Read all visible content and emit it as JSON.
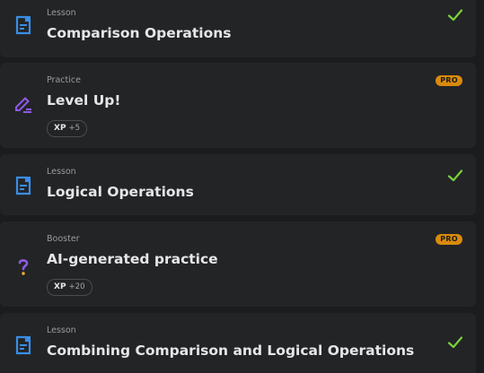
{
  "items": [
    {
      "type": "Lesson",
      "title": "Comparison Operations",
      "icon": "lesson-document-icon",
      "status": "completed"
    },
    {
      "type": "Practice",
      "title": "Level Up!",
      "icon": "pencil-practice-icon",
      "badge": "PRO",
      "xp_label": "XP",
      "xp_value": "+5"
    },
    {
      "type": "Lesson",
      "title": "Logical Operations",
      "icon": "lesson-document-icon",
      "status": "completed"
    },
    {
      "type": "Booster",
      "title": "AI-generated practice",
      "icon": "question-mark-icon",
      "badge": "PRO",
      "xp_label": "XP",
      "xp_value": "+20"
    },
    {
      "type": "Lesson",
      "title": "Combining Comparison and Logical Operations",
      "icon": "lesson-document-icon",
      "status": "completed"
    }
  ],
  "colors": {
    "background": "#1b1c1e",
    "card": "#232426",
    "lesson_icon": "#3a8ee6",
    "practice_icon": "#8f5be8",
    "check": "#7ad03a",
    "pro_badge": "#d98a0b"
  }
}
